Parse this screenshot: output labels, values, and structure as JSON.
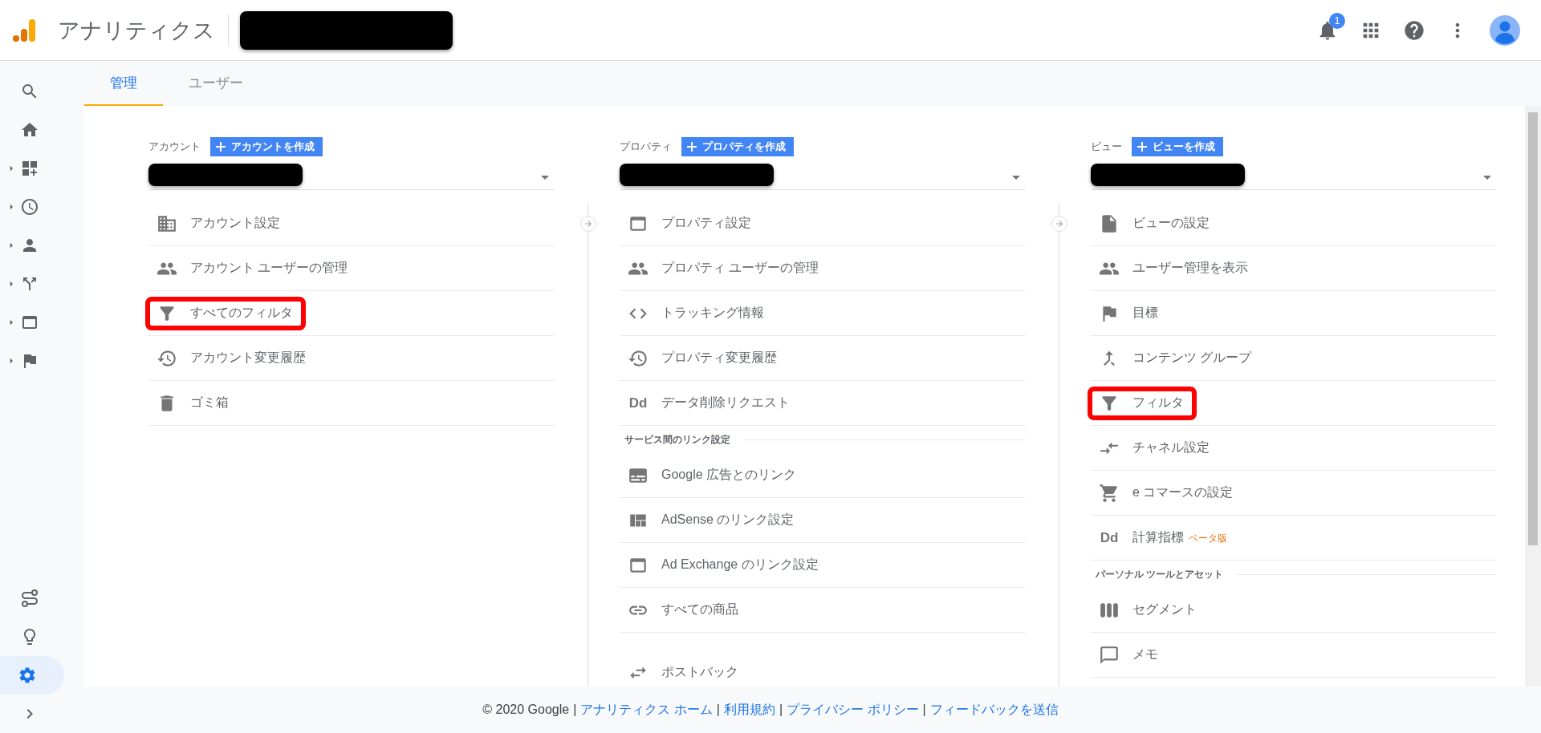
{
  "topbar": {
    "app_title": "アナリティクス",
    "account_redacted": true,
    "notification_count": "1"
  },
  "sidebar": {
    "top": [
      {
        "kind": "search",
        "expandable": false,
        "selected": false
      },
      {
        "kind": "home",
        "expandable": false,
        "selected": false
      },
      {
        "kind": "dashboards",
        "expandable": true,
        "selected": false
      },
      {
        "kind": "clock",
        "expandable": true,
        "selected": false
      },
      {
        "kind": "person",
        "expandable": true,
        "selected": false
      },
      {
        "kind": "branch",
        "expandable": true,
        "selected": false
      },
      {
        "kind": "window",
        "expandable": true,
        "selected": false
      },
      {
        "kind": "flag",
        "expandable": true,
        "selected": false
      }
    ],
    "bottom": [
      {
        "kind": "route",
        "expandable": false,
        "selected": false
      },
      {
        "kind": "bulb",
        "expandable": false,
        "selected": false
      },
      {
        "kind": "gear",
        "expandable": false,
        "selected": true
      },
      {
        "kind": "chevron",
        "expandable": false,
        "selected": false
      }
    ]
  },
  "tabs": [
    {
      "label": "管理",
      "selected": true
    },
    {
      "label": "ユーザー",
      "selected": false
    }
  ],
  "columns": [
    {
      "label": "アカウント",
      "create_button": "アカウントを作成",
      "selector_redacted": true,
      "sections": [
        {
          "items": [
            {
              "kind": "building",
              "label": "アカウント設定",
              "highlighted": false
            },
            {
              "kind": "people",
              "label": "アカウント ユーザーの管理",
              "highlighted": false
            },
            {
              "kind": "funnel",
              "label": "すべてのフィルタ",
              "highlighted": true
            },
            {
              "kind": "history",
              "label": "アカウント変更履歴",
              "highlighted": false
            },
            {
              "kind": "trash",
              "label": "ゴミ箱",
              "highlighted": false
            }
          ]
        }
      ]
    },
    {
      "label": "プロパティ",
      "create_button": "プロパティを作成",
      "selector_redacted": true,
      "sections": [
        {
          "items": [
            {
              "kind": "panel",
              "label": "プロパティ設定",
              "highlighted": false
            },
            {
              "kind": "people",
              "label": "プロパティ ユーザーの管理",
              "highlighted": false
            },
            {
              "kind": "code",
              "label": "トラッキング情報",
              "highlighted": false
            },
            {
              "kind": "history",
              "label": "プロパティ変更履歴",
              "highlighted": false
            },
            {
              "kind": "letters",
              "glyph": "Dd",
              "label": "データ削除リクエスト",
              "highlighted": false
            }
          ]
        },
        {
          "heading": "サービス間のリンク設定",
          "items": [
            {
              "kind": "ads",
              "label": "Google 広告とのリンク",
              "highlighted": false
            },
            {
              "kind": "quilt",
              "label": "AdSense のリンク設定",
              "highlighted": false
            },
            {
              "kind": "panel",
              "label": "Ad Exchange のリンク設定",
              "highlighted": false
            },
            {
              "kind": "link",
              "label": "すべての商品",
              "highlighted": false
            }
          ]
        },
        {
          "items": [
            {
              "kind": "swap",
              "label": "ポストバック",
              "highlighted": false
            }
          ]
        }
      ]
    },
    {
      "label": "ビュー",
      "create_button": "ビューを作成",
      "selector_redacted": true,
      "sections": [
        {
          "items": [
            {
              "kind": "file",
              "label": "ビューの設定",
              "highlighted": false
            },
            {
              "kind": "people",
              "label": "ユーザー管理を表示",
              "highlighted": false
            },
            {
              "kind": "flag",
              "label": "目標",
              "highlighted": false
            },
            {
              "kind": "merge",
              "label": "コンテンツ グループ",
              "highlighted": false
            },
            {
              "kind": "funnel",
              "label": "フィルタ",
              "highlighted": true
            },
            {
              "kind": "channels",
              "label": "チャネル設定",
              "highlighted": false
            },
            {
              "kind": "cart",
              "label": "e コマースの設定",
              "highlighted": false
            },
            {
              "kind": "letters",
              "glyph": "Dd",
              "label": "計算指標",
              "badge": "ベータ版",
              "highlighted": false
            }
          ]
        },
        {
          "heading": "パーソナル ツールとアセット",
          "items": [
            {
              "kind": "segments",
              "label": "セグメント",
              "highlighted": false
            },
            {
              "kind": "memo",
              "label": "メモ",
              "highlighted": false
            }
          ]
        }
      ]
    }
  ],
  "footer": {
    "copyright": "© 2020 Google",
    "separator": "|",
    "links": [
      "アナリティクス ホーム",
      "利用規約",
      "プライバシー ポリシー",
      "フィードバックを送信"
    ]
  }
}
